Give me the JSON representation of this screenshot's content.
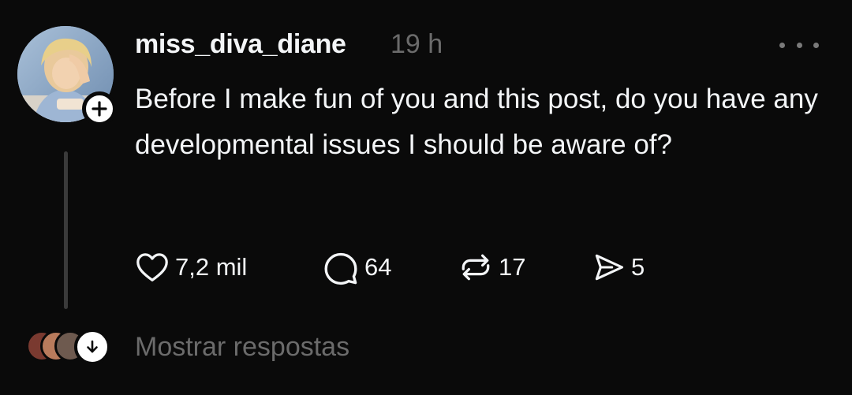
{
  "post": {
    "username": "miss_diva_diane",
    "timestamp": "19 h",
    "text": "Before I make fun of you and this post, do you have any developmental issues I should be aware of?"
  },
  "actions": {
    "likes": "7,2 mil",
    "replies": "64",
    "reposts": "17",
    "shares": "5"
  },
  "footer": {
    "show_replies_label": "Mostrar respostas"
  },
  "icons": {
    "follow": "plus-icon",
    "more": "more-horizontal-icon",
    "like": "heart-icon",
    "reply": "comment-icon",
    "repost": "repost-icon",
    "share": "send-icon",
    "show_replies": "arrow-down-icon"
  },
  "colors": {
    "background": "#0a0a0a",
    "text_primary": "#f3f5f7",
    "text_secondary": "#6b6b6b",
    "thread_line": "#3a3a3a"
  }
}
